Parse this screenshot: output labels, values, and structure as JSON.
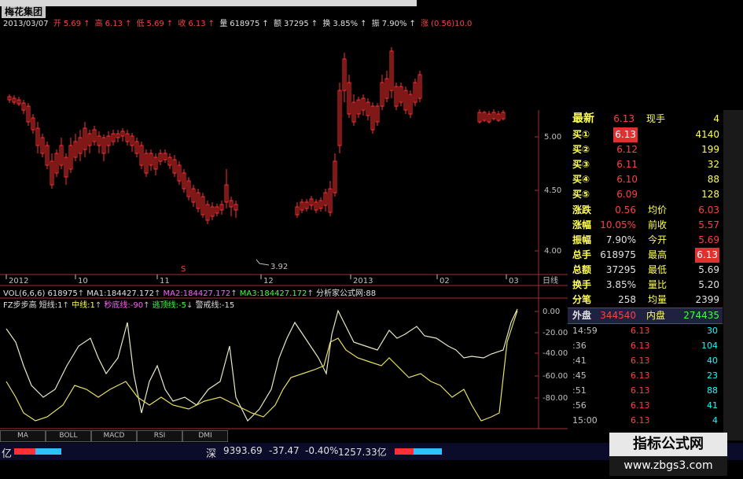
{
  "window": {
    "title": "梅花集团"
  },
  "header": {
    "date": "2013/03/07",
    "open_label": "开",
    "open": "5.69",
    "high_label": "高",
    "high": "6.13",
    "low_label": "低",
    "low": "5.69",
    "close_label": "收",
    "close": "6.13",
    "volume_label": "量",
    "volume": "618975",
    "amount_label": "额",
    "amount": "37295",
    "turnover_label": "换",
    "turnover": "3.85%",
    "amplitude_label": "振",
    "amplitude": "7.90%",
    "change_label": "涨",
    "change": "(0.56)10.0"
  },
  "price_axis": [
    "5.00",
    "4.50",
    "4.00"
  ],
  "low_annotation": "3.92",
  "time_axis": {
    "labels": [
      "2012",
      "10",
      "11",
      "12",
      "2013",
      "02",
      "03"
    ],
    "period": "日线"
  },
  "volume_line": {
    "label": "VOL(6,6,6)",
    "vol": "618975",
    "ma1_label": "MA1",
    "ma1": "184427.172",
    "ma2_label": "MA2",
    "ma2": "184427.172",
    "ma3_label": "MA3",
    "ma3": "184427.172",
    "source": "分析家公式网:88"
  },
  "indicator_line": {
    "name": "FZ步步高",
    "l1": "短线:1",
    "l2": "中线:1",
    "l3": "秒底线:-90",
    "l4": "逃顶线:-5",
    "l5": "警戒线:-15"
  },
  "indicator_axis": [
    "0.00",
    "-20.00",
    "-40.00",
    "-60.00",
    "-80.00"
  ],
  "quote": {
    "latest_label": "最新",
    "latest": "6.13",
    "current_hand_label": "现手",
    "current_hand": "4",
    "bids": [
      {
        "label": "买①",
        "price": "6.13",
        "qty": "4140"
      },
      {
        "label": "买②",
        "price": "6.12",
        "qty": "199"
      },
      {
        "label": "买③",
        "price": "6.11",
        "qty": "32"
      },
      {
        "label": "买④",
        "price": "6.10",
        "qty": "88"
      },
      {
        "label": "买⑤",
        "price": "6.09",
        "qty": "128"
      }
    ],
    "stats": [
      {
        "l": "涨跌",
        "v": "0.56",
        "l2": "均价",
        "v2": "6.03"
      },
      {
        "l": "涨幅",
        "v": "10.05%",
        "l2": "前收",
        "v2": "5.57"
      },
      {
        "l": "振幅",
        "v": "7.90%",
        "l2": "今开",
        "v2": "5.69"
      },
      {
        "l": "总手",
        "v": "618975",
        "l2": "最高",
        "v2": "6.13"
      },
      {
        "l": "总额",
        "v": "37295",
        "l2": "最低",
        "v2": "5.69"
      },
      {
        "l": "换手",
        "v": "3.85%",
        "l2": "量比",
        "v2": "5.20"
      },
      {
        "l": "分笔",
        "v": "258",
        "l2": "均量",
        "v2": "2399"
      }
    ],
    "outer_label": "外盘",
    "outer": "344540",
    "inner_label": "内盘",
    "inner": "274435"
  },
  "ticks": [
    {
      "t": "14:59",
      "p": "6.13",
      "q": "30"
    },
    {
      "t": ":36",
      "p": "6.13",
      "q": "104"
    },
    {
      "t": ":41",
      "p": "6.13",
      "q": "40"
    },
    {
      "t": ":45",
      "p": "6.13",
      "q": "23"
    },
    {
      "t": ":51",
      "p": "6.13",
      "q": "88"
    },
    {
      "t": ":56",
      "p": "6.13",
      "q": "41"
    },
    {
      "t": "15:00",
      "p": "6.13",
      "q": "4"
    }
  ],
  "tabs": [
    "MA",
    "BOLL",
    "MACD",
    "RSI",
    "DMI"
  ],
  "status": {
    "unit_left": "亿",
    "market": "深",
    "index": "9393.69",
    "change": "-37.47",
    "pct": "-0.40%",
    "amount": "1257.33亿"
  },
  "watermark": {
    "title": "指标公式网",
    "url": "www.zbgs3.com"
  },
  "chart_data": {
    "type": "candlestick",
    "ylim": [
      3.8,
      6.6
    ]
  }
}
